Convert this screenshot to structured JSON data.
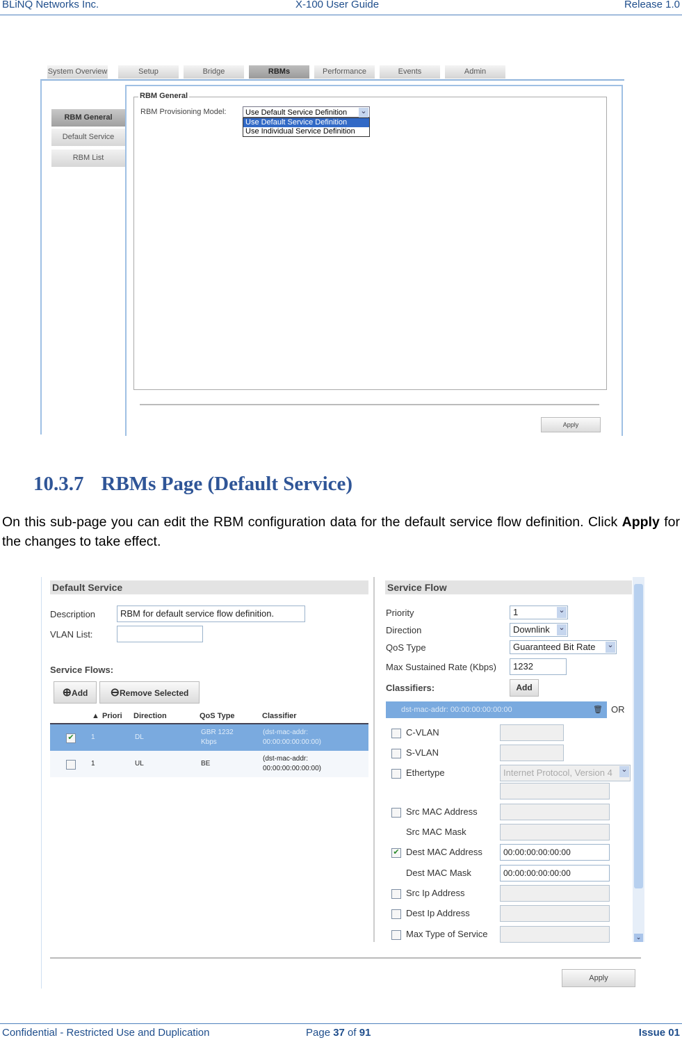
{
  "header": {
    "left": "BLiNQ Networks Inc.",
    "center": "X-100 User Guide",
    "right": "Release 1.0"
  },
  "footer": {
    "left": "Confidential - Restricted Use and Duplication",
    "page_prefix": "Page ",
    "page": "37",
    "page_of": " of ",
    "pages": "91",
    "right": "Issue 01"
  },
  "shot1": {
    "tabs": [
      "System Overview",
      "Setup",
      "Bridge",
      "RBMs",
      "Performance",
      "Events",
      "Admin"
    ],
    "active_tab": "RBMs",
    "side": [
      "RBM General",
      "Default Service",
      "RBM List"
    ],
    "fieldset": "RBM General",
    "model_label": "RBM Provisioning Model:",
    "model_value": "Use Default Service Definition",
    "options": [
      "Use Default Service Definition",
      "Use Individual Service Definition"
    ],
    "apply": "Apply"
  },
  "section": {
    "number": "10.3.7",
    "title": "RBMs Page (Default Service)",
    "para1": "On this sub-page you can edit the RBM configuration data for the default service flow definition. Click ",
    "para_bold": "Apply",
    "para2": " for the changes to take effect."
  },
  "shot2": {
    "left_title": "Default Service",
    "description_label": "Description",
    "description_value": "RBM for default service flow definition.",
    "vlan_label": "VLAN List:",
    "vlan_value": "",
    "flows_label": "Service Flows:",
    "add": "Add",
    "remove": "Remove Selected",
    "columns": [
      "Priori",
      "Direction",
      "QoS Type",
      "Classifier"
    ],
    "rows": [
      {
        "checked": true,
        "priority": "1",
        "direction": "DL",
        "qos": "GBR 1232 Kbps",
        "classifier": "(dst-mac-addr: 00:00:00:00:00:00)"
      },
      {
        "checked": false,
        "priority": "1",
        "direction": "UL",
        "qos": "BE",
        "classifier": "(dst-mac-addr: 00:00:00:00:00:00)"
      }
    ],
    "right_title": "Service Flow",
    "priority_label": "Priority",
    "priority_value": "1",
    "direction_label": "Direction",
    "direction_value": "Downlink",
    "qos_label": "QoS Type",
    "qos_value": "Guaranteed Bit Rate",
    "rate_label": "Max Sustained Rate (Kbps)",
    "rate_value": "1232",
    "classifiers_label": "Classifiers:",
    "classifiers_add": "Add",
    "classifier_item": "dst-mac-addr: 00:00:00:00:00:00",
    "or": "OR",
    "fields": [
      {
        "label": "C-VLAN",
        "checkbox": true,
        "checked": false,
        "value": ""
      },
      {
        "label": "S-VLAN",
        "checkbox": true,
        "checked": false,
        "value": ""
      },
      {
        "label": "Ethertype",
        "checkbox": true,
        "checked": false,
        "value": "Internet Protocol, Version 4"
      },
      {
        "label": "Src MAC Address",
        "checkbox": true,
        "checked": false,
        "value": ""
      },
      {
        "label": "Src MAC Mask",
        "checkbox": false,
        "value": ""
      },
      {
        "label": "Dest MAC Address",
        "checkbox": true,
        "checked": true,
        "value": "00:00:00:00:00:00"
      },
      {
        "label": "Dest MAC Mask",
        "checkbox": false,
        "value": "00:00:00:00:00:00"
      },
      {
        "label": "Src Ip Address",
        "checkbox": true,
        "checked": false,
        "value": ""
      },
      {
        "label": "Dest Ip Address",
        "checkbox": true,
        "checked": false,
        "value": ""
      },
      {
        "label": "Max Type of Service",
        "checkbox": true,
        "checked": false,
        "value": ""
      }
    ],
    "apply": "Apply"
  }
}
